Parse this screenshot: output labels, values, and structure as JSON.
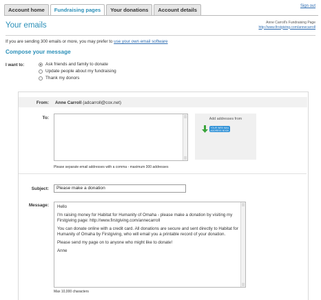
{
  "tabs": [
    {
      "label": "Account home",
      "active": false
    },
    {
      "label": "Fundraising pages",
      "active": true
    },
    {
      "label": "Your donations",
      "active": false
    },
    {
      "label": "Account details",
      "active": false
    }
  ],
  "signout": "Sign out",
  "title": "Your emails",
  "fundraising_page": {
    "name": "Anne Carroll's Fundraising Page",
    "url": "http://www.firstgiving.com/annecarroll"
  },
  "note": {
    "prefix": "If you are sending 300 emails or more, you may prefer to ",
    "link": "use your own email software"
  },
  "compose_heading": "Compose your message",
  "iwant": {
    "label": "I want to:",
    "options": [
      {
        "label": "Ask friends and family to donate",
        "checked": true
      },
      {
        "label": "Update people about my fundraising",
        "checked": false
      },
      {
        "label": "Thank my donors",
        "checked": false
      }
    ]
  },
  "from": {
    "label": "From:",
    "name": "Anne Carroll",
    "email": "(adcarroll@cox.net)"
  },
  "to": {
    "label": "To:",
    "value": "",
    "hint": "Please separate email addresses with a comma - maximum 300 addresses",
    "add_from_label": "Add addresses from",
    "add_button_text": "YOUR WEB MAIL ADDRESS BOOK"
  },
  "subject": {
    "label": "Subject:",
    "value": "Please make a donation"
  },
  "message": {
    "label": "Message:",
    "paragraphs": [
      "Hello",
      "I'm raising money for Habitat for Humanity of Omaha - please make a donation by visiting my Firstgiving page: http://www.firstgiving.com/annecarroll",
      "You can donate online with a credit card. All donations are secure and sent directly to Habitat for Humanity of Omaha by Firstgiving, who will email you a printable record of your donation.",
      "Please send my page on to anyone who might like to donate!",
      "Anne"
    ],
    "max_chars": "Max 10,000 characters"
  },
  "colors": {
    "accent": "#2a8fb8",
    "link": "#2a6ab0",
    "button": "#2b8fd6",
    "panel": "#f0f0f0"
  }
}
